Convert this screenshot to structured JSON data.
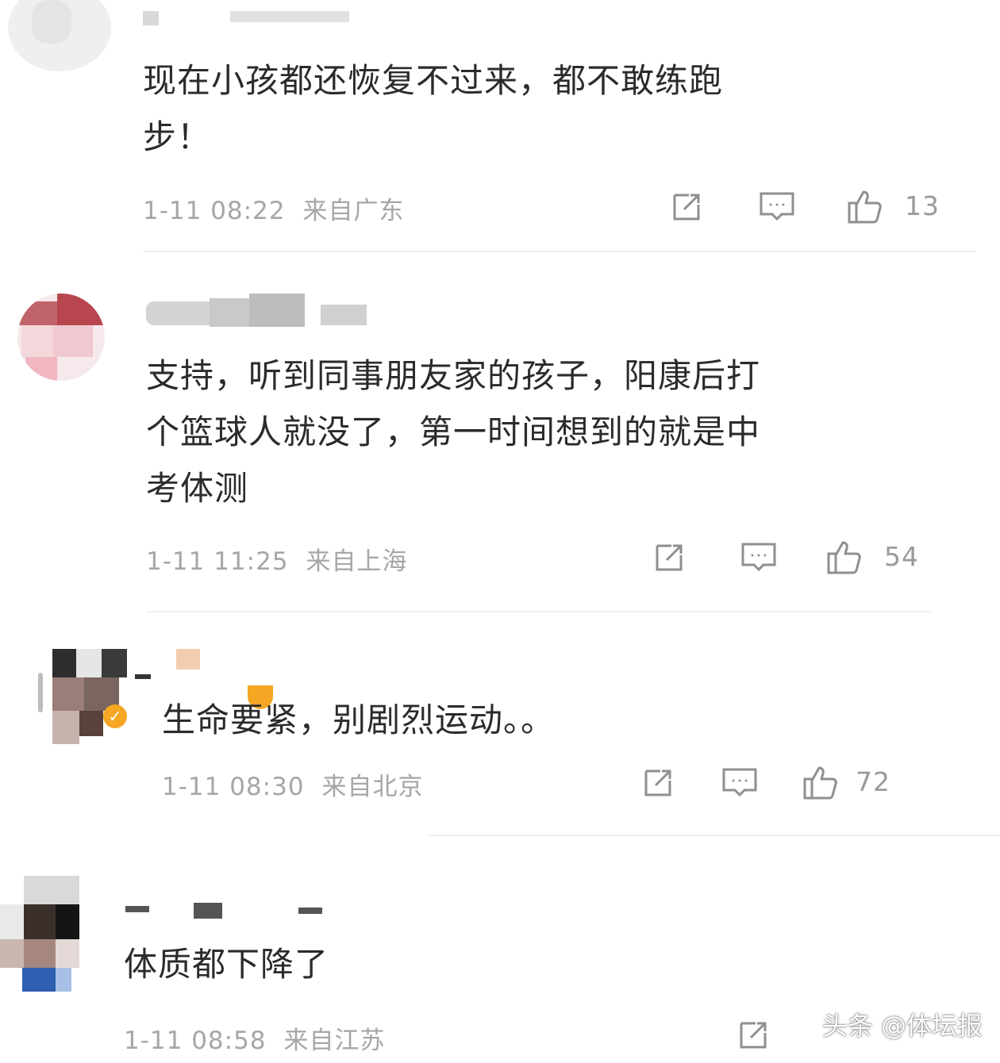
{
  "comments": [
    {
      "text_lines": [
        "现在小孩都还恢复不过来，都不敢练跑",
        "步！"
      ],
      "date": "1-11 08:22",
      "location": "来自广东",
      "likes": "13"
    },
    {
      "text_lines": [
        "支持，听到同事朋友家的孩子，阳康后打",
        "个篮球人就没了，第一时间想到的就是中",
        "考体测"
      ],
      "date": "1-11 11:25",
      "location": "来自上海",
      "likes": "54"
    },
    {
      "text_lines": [
        "生命要紧，别剧烈运动。。"
      ],
      "date": "1-11 08:30",
      "location": "来自北京",
      "likes": "72"
    },
    {
      "text_lines": [
        "体质都下降了"
      ],
      "date": "1-11 08:58",
      "location": "来自江苏",
      "likes": ""
    }
  ],
  "icons": {
    "share": "share-icon",
    "reply": "comment-icon",
    "like": "thumbs-up-icon"
  },
  "watermark": "头条 @体坛报",
  "colors": {
    "text": "#2b2b2b",
    "meta": "#a6a6a6",
    "icon": "#8f8f8f",
    "badge": "#f5a623"
  }
}
